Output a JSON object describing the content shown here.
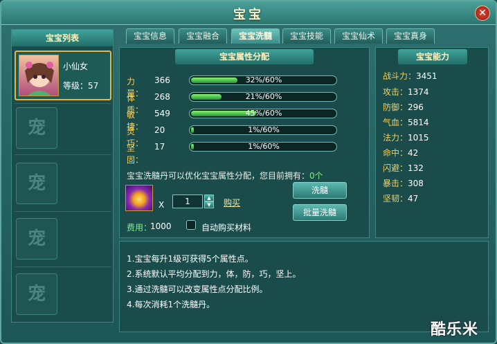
{
  "window": {
    "title": "宝宝",
    "close": "✕"
  },
  "list": {
    "header": "宝宝列表",
    "pet": {
      "name": "小仙女",
      "level_label": "等级：57"
    },
    "empty_slot_glyph": "宠"
  },
  "tabs": [
    "宝宝信息",
    "宝宝融合",
    "宝宝洗髓",
    "宝宝技能",
    "宝宝仙术",
    "宝宝真身"
  ],
  "active_tab": "宝宝洗髓",
  "attributes": {
    "header": "宝宝属性分配",
    "rows": [
      {
        "label": "力量：",
        "value": "366",
        "pct": "32%/60%",
        "fill": 0.32
      },
      {
        "label": "体质：",
        "value": "268",
        "pct": "21%/60%",
        "fill": 0.21
      },
      {
        "label": "敏捷：",
        "value": "549",
        "pct": "45%/60%",
        "fill": 0.45
      },
      {
        "label": "灵巧：",
        "value": "20",
        "pct": "1%/60%",
        "fill": 0.01
      },
      {
        "label": "坚固：",
        "value": "17",
        "pct": "1%/60%",
        "fill": 0.01
      }
    ]
  },
  "refine": {
    "notice": "宝宝洗髓丹可以优化宝宝属性分配，您目前拥有：",
    "owned": "0个",
    "times": "X",
    "quantity": "1",
    "buy": "购买",
    "fee_label": "费用：",
    "fee_value": "1000",
    "auto_buy": "自动购买材料",
    "btn_refine": "洗髓",
    "btn_batch": "批量洗髓"
  },
  "ability": {
    "header": "宝宝能力",
    "stats": [
      {
        "label": "战斗力：",
        "value": "3451"
      },
      {
        "label": "攻击：",
        "value": "1374"
      },
      {
        "label": "防御：",
        "value": "296"
      },
      {
        "label": "气血：",
        "value": "5814"
      },
      {
        "label": "法力：",
        "value": "1015"
      },
      {
        "label": "命中：",
        "value": "42"
      },
      {
        "label": "闪避：",
        "value": "132"
      },
      {
        "label": "暴击：",
        "value": "308"
      },
      {
        "label": "坚韧：",
        "value": "47"
      }
    ]
  },
  "tips": [
    "1.宝宝每升1级可获得5个属性点。",
    "2.系统默认平均分配到力，体，防，巧，坚上。",
    "3.通过洗髓可以改变属性点分配比例。",
    "4.每次消耗1个洗髓丹。"
  ],
  "watermark": "酷乐米"
}
